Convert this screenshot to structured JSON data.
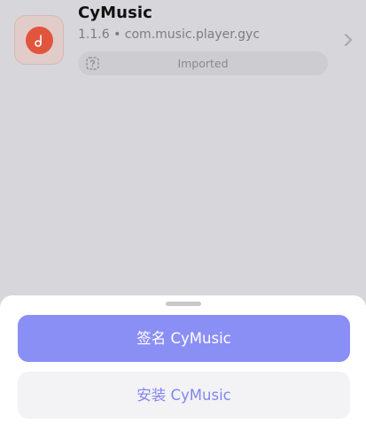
{
  "app": {
    "name": "CyMusic",
    "version": "1.1.6",
    "separator": "•",
    "bundle_id": "com.music.player.gyc",
    "icon": "music-note-icon",
    "icon_bg": "#e2553d",
    "status": "Imported",
    "status_icon": "question-square-icon"
  },
  "sheet": {
    "sign_label": "签名 CyMusic",
    "install_label": "安装 CyMusic",
    "accent": "#8a8ff6"
  }
}
